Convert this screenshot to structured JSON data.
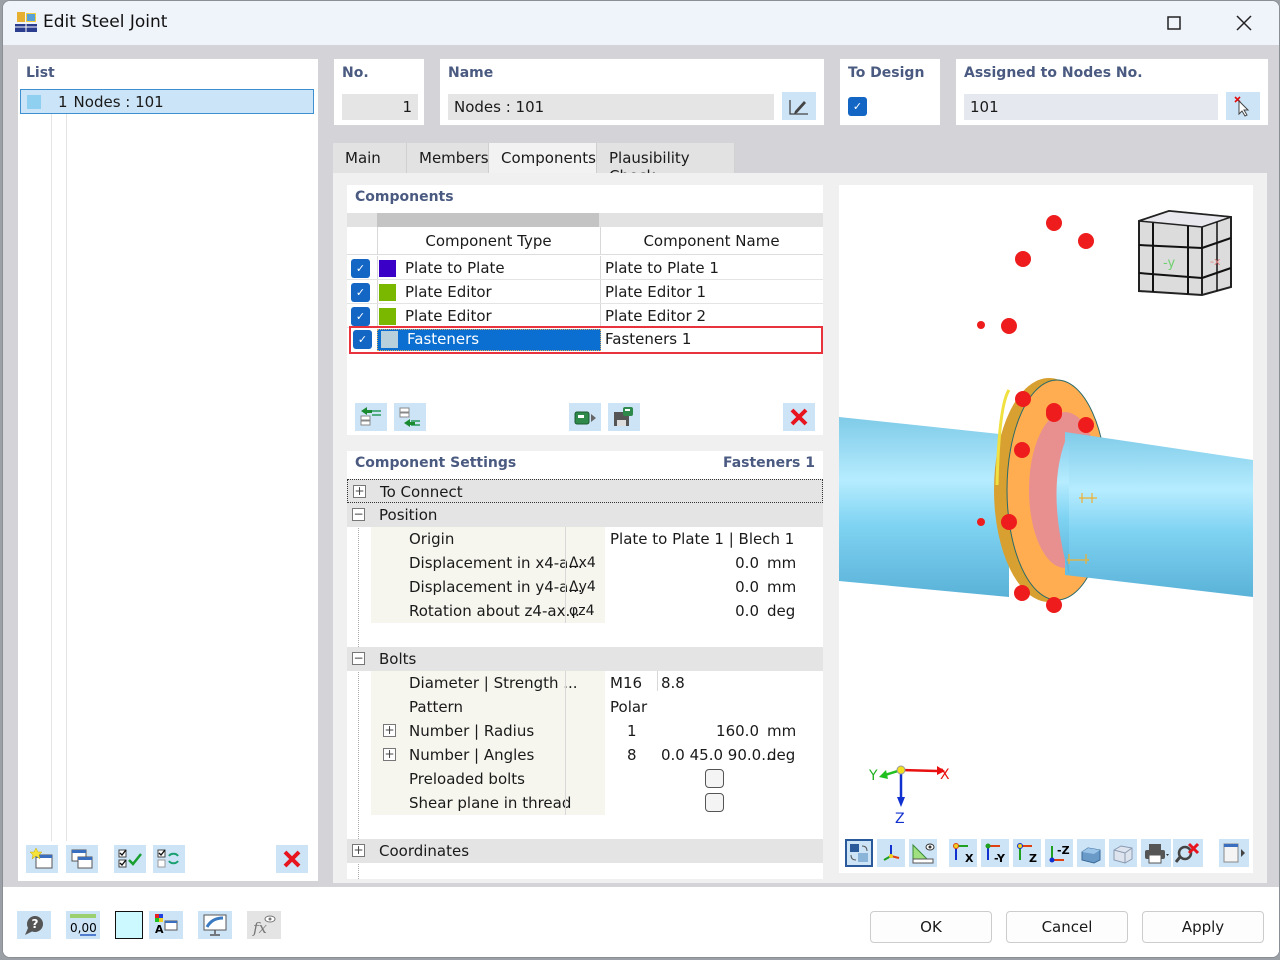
{
  "window": {
    "title": "Edit Steel Joint"
  },
  "list": {
    "header": "List",
    "items": [
      {
        "no": "1",
        "label": "Nodes : 101",
        "color": "#8fd0f0"
      }
    ]
  },
  "fields": {
    "no_label": "No.",
    "no_value": "1",
    "name_label": "Name",
    "name_value": "Nodes : 101",
    "to_design_label": "To Design",
    "to_design_checked": true,
    "assigned_label": "Assigned to Nodes No.",
    "assigned_value": "101"
  },
  "tabs": [
    {
      "label": "Main",
      "active": false
    },
    {
      "label": "Members",
      "active": false
    },
    {
      "label": "Components",
      "active": true
    },
    {
      "label": "Plausibility Check",
      "active": false
    }
  ],
  "components": {
    "header": "Components",
    "col_type": "Component Type",
    "col_name": "Component Name",
    "rows": [
      {
        "checked": true,
        "color": "#3a00c8",
        "type": "Plate to Plate",
        "name": "Plate to Plate 1",
        "selected": false
      },
      {
        "checked": true,
        "color": "#7ab800",
        "type": "Plate Editor",
        "name": "Plate Editor 1",
        "selected": false
      },
      {
        "checked": true,
        "color": "#7ab800",
        "type": "Plate Editor",
        "name": "Plate Editor 2",
        "selected": false
      },
      {
        "checked": true,
        "color": "#b8d0dc",
        "type": "Fasteners",
        "name": "Fasteners 1",
        "selected": true
      }
    ]
  },
  "settings": {
    "header": "Component Settings",
    "current": "Fasteners 1",
    "groups": {
      "to_connect": "To Connect",
      "position": "Position",
      "bolts": "Bolts",
      "coordinates": "Coordinates"
    },
    "position": {
      "origin_label": "Origin",
      "origin_value": "Plate to Plate 1 | Blech 1",
      "dx_label": "Displacement in x4-a...",
      "dx_sym": "Δx4",
      "dx_value": "0.0",
      "dx_unit": "mm",
      "dy_label": "Displacement in y4-a...",
      "dy_sym": "Δy4",
      "dy_value": "0.0",
      "dy_unit": "mm",
      "rz_label": "Rotation about z4-ax...",
      "rz_sym": "φz4",
      "rz_value": "0.0",
      "rz_unit": "deg"
    },
    "bolts": {
      "diameter_label": "Diameter | Strength ...",
      "diameter_value": "M16",
      "strength_value": "8.8",
      "pattern_label": "Pattern",
      "pattern_value": "Polar",
      "radius_label": "Number | Radius",
      "radius_number": "1",
      "radius_value": "160.0",
      "radius_unit": "mm",
      "angles_label": "Number | Angles",
      "angles_number": "8",
      "angles_value": "0.0 45.0 90.0...",
      "angles_unit": "deg",
      "preloaded_label": "Preloaded bolts",
      "preloaded_checked": false,
      "shear_label": "Shear plane in thread",
      "shear_checked": false
    }
  },
  "viewport": {
    "cube_labels": {
      "front": "-y",
      "side": "-x"
    },
    "axes": {
      "x": "X",
      "y": "Y",
      "z": "Z"
    },
    "toolbar_labels": {
      "view_x": "X",
      "view_neg_y": "-Y",
      "view_z": "Z",
      "view_neg_z": "-Z"
    }
  },
  "bottom_tools": {
    "decimal_label": "0,00"
  },
  "buttons": {
    "ok": "OK",
    "cancel": "Cancel",
    "apply": "Apply"
  }
}
